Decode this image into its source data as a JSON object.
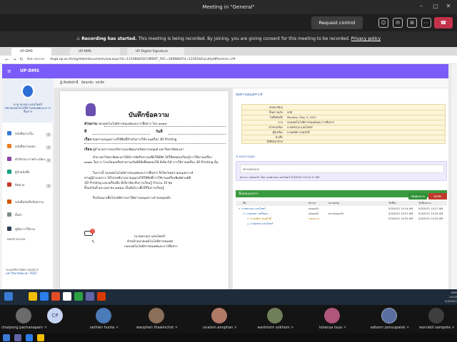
{
  "meeting": {
    "title": "Meeting in \"General\"",
    "request_control": "Request control",
    "banner_strong": "Recording has started.",
    "banner_text": " This meeting is being recorded. By joining, you are giving consent for this meeting to be recorded. ",
    "banner_link": "Privacy policy"
  },
  "browser": {
    "tabs": [
      "UP-DMS",
      "UP-DMS",
      "UP Digital Signature"
    ],
    "not_secure": "Not secure",
    "url": "dnga.up.ac.th/sig/date/documentview.aspx?id=12168&DOCUMENT_FAC=30968&FId=12301&FacultyIdReceive=2#"
  },
  "app": {
    "title": "UP-DMS",
    "user_name": "นาย ทรงกุล แสนโคตร์",
    "user_role": "หน่วยเทคโนโลยีสารสนเทศและการสื่อสาร",
    "menu": [
      {
        "label": "หนังสือภายใน",
        "badge": "0"
      },
      {
        "label": "หนังสือภายนอก",
        "badge": "0"
      },
      {
        "label": "คำสั่ง/ประกาศ/ระเบียบ",
        "badge": "0"
      },
      {
        "label": "ผู้รับหนังสือ",
        "badge": ""
      },
      {
        "label": "ติดตาม",
        "badge": "0"
      },
      {
        "label": "หนังสือบันทึกข้อความ",
        "badge": ""
      },
      {
        "label": "ตั้งค่า",
        "badge": ""
      },
      {
        "label": "คู่มือการใช้งาน",
        "badge": ""
      },
      {
        "label": "ออกจากระบบ",
        "badge": ""
      }
    ],
    "footer_1": "ระบบบริหารจัดการเอกสาร",
    "footer_2": "มหาวิทยาลัยพะเยา 2021",
    "toolbar": [
      "พิมพ์หน้านี้",
      "ย้อนกลับ",
      "ยกเลิก"
    ]
  },
  "document": {
    "title": "บันทึกข้อความ",
    "agency_label": "ส่วนงาน",
    "agency_value": "กองเทคโนโลยีสารสนเทศและการสื่อสาร  โทร ๑๓๑๓",
    "number_label": "ที่",
    "date_label": "วันที่",
    "subject_label": "เรื่อง",
    "subject_value": "ขอความอนุเคราะห์ใช้สิทธิ์สำหรับการใช้งานเครื่อง 3D Printing",
    "to_label": "เรียน",
    "to_value": "ผู้อำนวยการกองบริหารและพัฒนาทรัพยากรมนุษย์ มหาวิทยาลัยพะเยา",
    "body": [
      "ด้วย มหาวิทยาลัยพะเยาได้มีการจัดกิจกรรมเพื่อให้นิสิต ได้ใช้ทดลองเรียนรู้การใช้งานเครื่อง",
      "๑๓๑๓ ในการ โรงเรียนเครือข่ายรวมกันที่มีสิทธิ์ทดลองใช้ ทีเดียวได้ การใช้งานเครื่อง 3D Printing นั้น",
      "",
      "ในการนี้ กองเทคโนโลยีสารสนเทศและการสื่อสาร จึงใคร่ขอความอนุเคราะห์",
      "ท่านผู้อำนวยการ ได้โปรดพิจารณาอนุญาตให้ใช้สิทธิ์การใช้งานเครื่องพิมพ์สามมิติ",
      "3D Printing และเครื่องมือ ที่เกี่ยวข้องกับการเรียนรู้ จำนวน 10 ชุด",
      "ตั้งแต่วันที่ ๑๓ เมษายน ๒๕๖๔ เป็นต้นไป เพื่อใช้ในการเรียนรู้",
      "",
      "จึงเรียนมาเพื่อโปรดพิจารณาให้ความอนุเคราะห์ ขอบคุณยิ่ง"
    ],
    "sign_name": "(นายทรงกุล แสนโคตร์)",
    "sign_pos_1": "หัวหน้าหน่วยเทคโนโลยีสารสนเทศ",
    "sign_pos_2": "กองเทคโนโลยีสารสนเทศและการสื่อสาร",
    "badge": "3"
  },
  "right_panel": {
    "heading": "ขอความอนุเคราะห์",
    "info": [
      {
        "k": "เลขทะเบียน",
        "v": ""
      },
      {
        "k": "ชั้นความลับ",
        "v": "ปกติ"
      },
      {
        "k": "วันที่หนังสือ",
        "v": "Monday, May 3, 2021"
      },
      {
        "k": "จาก",
        "v": "กองเทคโนโลยีสารสนเทศและการสื่อสาร"
      },
      {
        "k": "เจ้าของเรื่อง",
        "v": "นายทรงกุล แสนโคตร์"
      },
      {
        "k": "ผู้รับเรื่อง",
        "v": "นายอดิศร พรสุภักดิ์"
      },
      {
        "k": "อ้างถึง",
        "v": ""
      },
      {
        "k": "สิ่งที่ส่งมาด้วย",
        "v": ""
      }
    ],
    "comment_head": "เอกสารแนบ",
    "comment_placeholder": "ทราบ/ลงนาม",
    "comment_meta": "สถานะ: เสนอแล้ว โดย นายทรงกุล แสนโคตร์ 5/3/2021 10:22:11 AM",
    "table_title": "ขั้นตอนเอกสาร",
    "btn_1": "เพิ่มผู้ลงนาม",
    "btn_2": "ยกเลิก",
    "cols": [
      "ชื่อ",
      "สถานะ",
      "หมายเหตุ",
      "วันที่ส่ง",
      "วันที่ลงนาม"
    ],
    "rows": [
      {
        "name": "✔ นายทรงกุล แสนโคตร์",
        "status": "เสนอแล้ว",
        "note": "",
        "sent": "5/3/2021 10:14 AM",
        "signed": "5/3/2021 10:27 AM"
      },
      {
        "name": "✔ นายสุรพล วงศ์วัฒนา",
        "status": "เสนอแล้ว",
        "note": "ตรวจสอบแล้ว",
        "sent": "5/3/2021 10:27 AM",
        "signed": "5/3/2021 10:32 AM"
      },
      {
        "name": "✔ นายอดิศร พรสุภักดิ์",
        "status": "รอลงนาม",
        "note": "",
        "sent": "5/3/2021 10:32 AM",
        "signed": "5/3/2021 10:32 AM"
      },
      {
        "name": "□ นายสุรพล แสนโคตร์",
        "status": "",
        "note": "",
        "sent": "",
        "signed": ""
      }
    ]
  },
  "taskbar": {
    "time": "10:25",
    "date": "5/3/2021",
    "lang": "ENG"
  },
  "participants": [
    {
      "name": "chutpong pachanaparn",
      "initials": "",
      "color": "#6b6b6b"
    },
    {
      "name": "",
      "initials": "CP",
      "color": "#c7d3f2"
    },
    {
      "name": "sathien hunta",
      "initials": "",
      "color": "#4a7ab8"
    },
    {
      "name": "wanphen thawinchot",
      "initials": "",
      "color": "#8a6f5a"
    },
    {
      "name": "unalom anophan",
      "initials": "",
      "color": "#b07a66"
    },
    {
      "name": "warintorn sokhom",
      "initials": "",
      "color": "#6e7f5a"
    },
    {
      "name": "kolanya taya",
      "initials": "",
      "color": "#b0567a"
    },
    {
      "name": "adisorn ponsupalak",
      "initials": "",
      "color": "#5a6ea0"
    },
    {
      "name": "worrakit sampote",
      "initials": "",
      "color": "#3e3e3e"
    }
  ]
}
